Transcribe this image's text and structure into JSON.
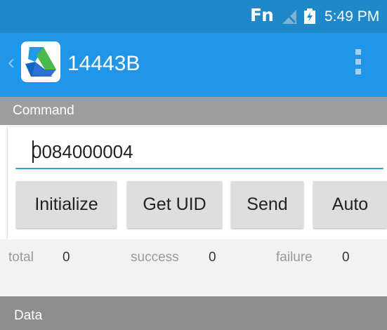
{
  "status_bar": {
    "fn_label": "Fn",
    "time": "5:49 PM",
    "icons": [
      "fn-icon",
      "no-signal-icon",
      "battery-charging-icon"
    ]
  },
  "app_bar": {
    "title": "14443B",
    "back_icon": "chevron-left-icon",
    "logo_icon": "app-logo-icon",
    "menu_icon": "overflow-menu-icon"
  },
  "command_section": {
    "header": "Command",
    "input_value": "0084000004"
  },
  "buttons": {
    "initialize": "Initialize",
    "get_uid": "Get UID",
    "send": "Send",
    "auto": "Auto"
  },
  "stats": {
    "total_label": "total",
    "total_value": "0",
    "success_label": "success",
    "success_value": "0",
    "failure_label": "failure",
    "failure_value": "0"
  },
  "data_section": {
    "header": "Data"
  },
  "colors": {
    "status_bar": "#1e88c9",
    "app_bar": "#2196e8",
    "section_header": "#9d9d9d",
    "input_underline": "#2ba5d8"
  }
}
